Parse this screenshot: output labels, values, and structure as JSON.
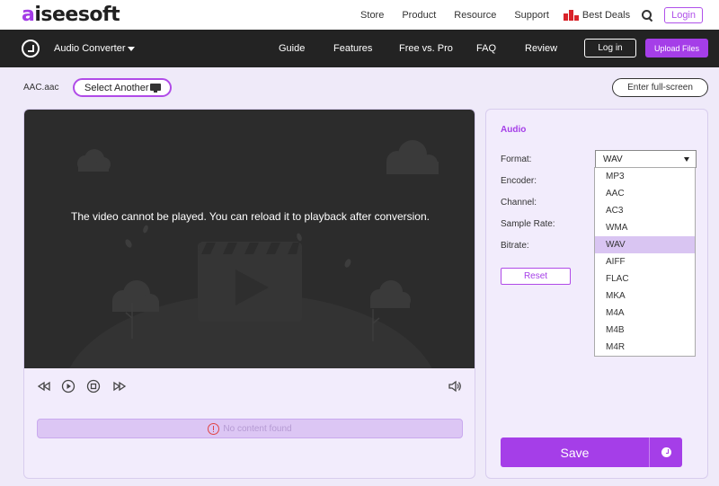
{
  "topbar": {
    "logo_accent": "a",
    "logo_rest": "iseesoft",
    "links": [
      "Store",
      "Product",
      "Resource",
      "Support"
    ],
    "deals": "Best Deals",
    "login": "Login"
  },
  "nav": {
    "title": "Audio Converter",
    "links": [
      "Guide",
      "Features",
      "Free vs. Pro",
      "FAQ",
      "Review"
    ],
    "login": "Log in",
    "upload": "Upload Files"
  },
  "file": {
    "name": "AAC.aac",
    "select_another": "Select Another",
    "fullscreen": "Enter full-screen"
  },
  "player": {
    "message": "The video cannot be played. You can reload it to playback after conversion.",
    "status": "No content found"
  },
  "settings": {
    "heading": "Audio",
    "labels": {
      "format": "Format:",
      "encoder": "Encoder:",
      "channel": "Channel:",
      "sample_rate": "Sample Rate:",
      "bitrate": "Bitrate:"
    },
    "format_value": "WAV",
    "reset": "Reset",
    "save": "Save",
    "format_options": [
      "MP3",
      "AAC",
      "AC3",
      "WMA",
      "WAV",
      "AIFF",
      "FLAC",
      "MKA",
      "M4A",
      "M4B",
      "M4R"
    ],
    "selected_option": "WAV"
  },
  "colors": {
    "accent": "#a53ee8",
    "dark_nav": "#232323",
    "video_bg": "#2c2c2c",
    "panel_bg": "#f2ecfc",
    "page_bg": "#efeaf9"
  }
}
